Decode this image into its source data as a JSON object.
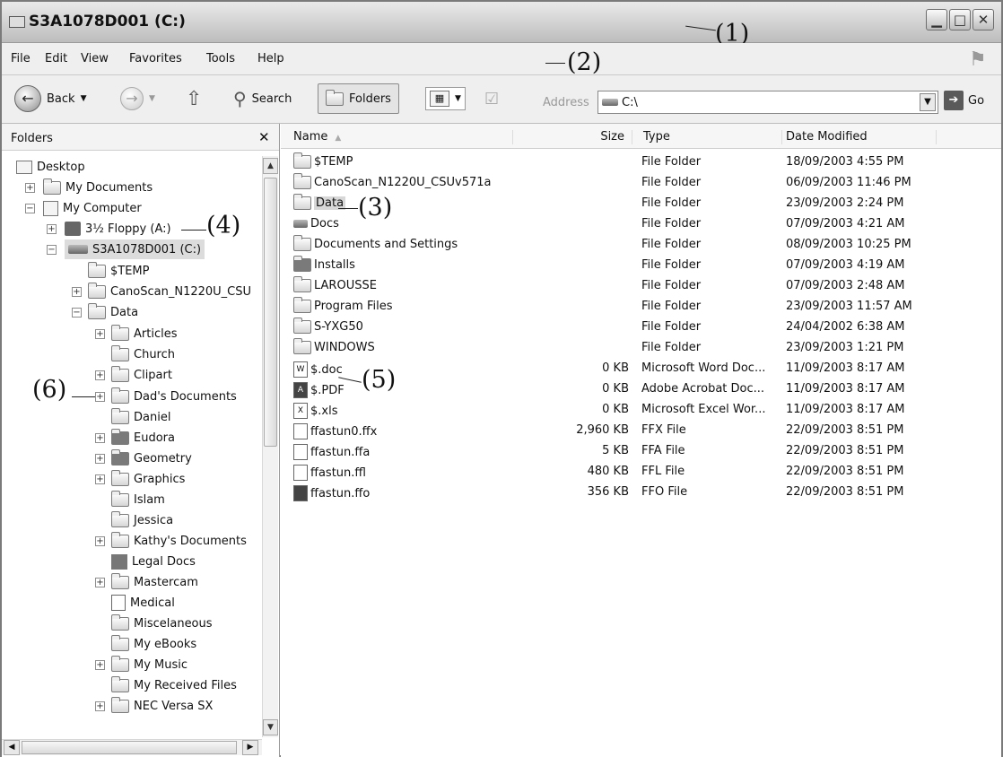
{
  "window": {
    "title": "S3A1078D001 (C:)"
  },
  "menu": [
    "File",
    "Edit",
    "View",
    "Favorites",
    "Tools",
    "Help"
  ],
  "toolbar": {
    "back": "Back",
    "search": "Search",
    "folders": "Folders",
    "address_label": "Address",
    "address_value": "C:\\",
    "go": "Go"
  },
  "callouts": [
    "(1)",
    "(2)",
    "(3)",
    "(4)",
    "(5)",
    "(6)"
  ],
  "folders_pane": {
    "title": "Folders",
    "tree": [
      {
        "label": "Desktop"
      },
      {
        "label": "My Documents"
      },
      {
        "label": "My Computer"
      },
      {
        "label": "3½ Floppy (A:)"
      },
      {
        "label": "S3A1078D001 (C:)"
      },
      {
        "label": "$TEMP"
      },
      {
        "label": "CanoScan_N1220U_CSU"
      },
      {
        "label": "Data"
      },
      {
        "label": "Articles"
      },
      {
        "label": "Church"
      },
      {
        "label": "Clipart"
      },
      {
        "label": "Dad's Documents"
      },
      {
        "label": "Daniel"
      },
      {
        "label": "Eudora"
      },
      {
        "label": "Geometry"
      },
      {
        "label": "Graphics"
      },
      {
        "label": "Islam"
      },
      {
        "label": "Jessica"
      },
      {
        "label": "Kathy's Documents"
      },
      {
        "label": "Legal Docs"
      },
      {
        "label": "Mastercam"
      },
      {
        "label": "Medical"
      },
      {
        "label": "Miscelaneous"
      },
      {
        "label": "My eBooks"
      },
      {
        "label": "My Music"
      },
      {
        "label": "My Received Files"
      },
      {
        "label": "NEC Versa SX"
      }
    ]
  },
  "file_list": {
    "columns": [
      "Name",
      "Size",
      "Type",
      "Date Modified"
    ],
    "rows": [
      {
        "name": "$TEMP",
        "size": "",
        "type": "File Folder",
        "date": "18/09/2003 4:55 PM"
      },
      {
        "name": "CanoScan_N1220U_CSUv571a",
        "size": "",
        "type": "File Folder",
        "date": "06/09/2003 11:46 PM"
      },
      {
        "name": "Data",
        "size": "",
        "type": "File Folder",
        "date": "23/09/2003 2:24 PM"
      },
      {
        "name": "Docs",
        "size": "",
        "type": "File Folder",
        "date": "07/09/2003 4:21 AM"
      },
      {
        "name": "Documents and Settings",
        "size": "",
        "type": "File Folder",
        "date": "08/09/2003 10:25 PM"
      },
      {
        "name": "Installs",
        "size": "",
        "type": "File Folder",
        "date": "07/09/2003 4:19 AM"
      },
      {
        "name": "LAROUSSE",
        "size": "",
        "type": "File Folder",
        "date": "07/09/2003 2:48 AM"
      },
      {
        "name": "Program Files",
        "size": "",
        "type": "File Folder",
        "date": "23/09/2003 11:57 AM"
      },
      {
        "name": "S-YXG50",
        "size": "",
        "type": "File Folder",
        "date": "24/04/2002 6:38 AM"
      },
      {
        "name": "WINDOWS",
        "size": "",
        "type": "File Folder",
        "date": "23/09/2003 1:21 PM"
      },
      {
        "name": "$.doc",
        "size": "0 KB",
        "type": "Microsoft Word Doc...",
        "date": "11/09/2003 8:17 AM"
      },
      {
        "name": "$.PDF",
        "size": "0 KB",
        "type": "Adobe Acrobat Doc...",
        "date": "11/09/2003 8:17 AM"
      },
      {
        "name": "$.xls",
        "size": "0 KB",
        "type": "Microsoft Excel Wor...",
        "date": "11/09/2003 8:17 AM"
      },
      {
        "name": "ffastun0.ffx",
        "size": "2,960 KB",
        "type": "FFX File",
        "date": "22/09/2003 8:51 PM"
      },
      {
        "name": "ffastun.ffa",
        "size": "5 KB",
        "type": "FFA File",
        "date": "22/09/2003 8:51 PM"
      },
      {
        "name": "ffastun.ffl",
        "size": "480 KB",
        "type": "FFL File",
        "date": "22/09/2003 8:51 PM"
      },
      {
        "name": "ffastun.ffo",
        "size": "356 KB",
        "type": "FFO File",
        "date": "22/09/2003 8:51 PM"
      }
    ]
  }
}
